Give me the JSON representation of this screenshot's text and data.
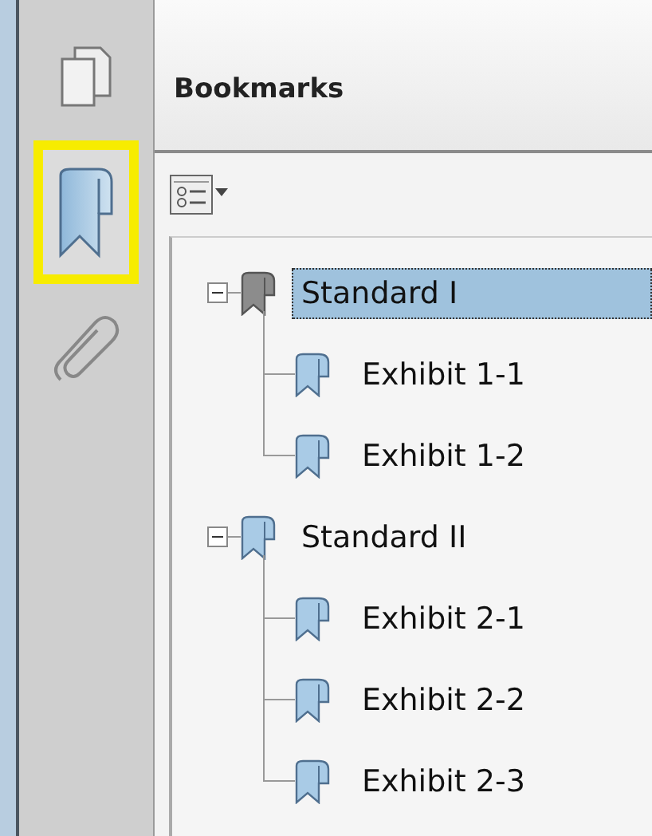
{
  "sidebar": {
    "tabs": [
      {
        "kind": "pages",
        "selected": false
      },
      {
        "kind": "bookmarks",
        "selected": true
      },
      {
        "kind": "attachments",
        "selected": false
      }
    ]
  },
  "panel": {
    "title": "Bookmarks"
  },
  "tree": [
    {
      "label": "Standard I",
      "expanded": true,
      "selected": true,
      "children": [
        {
          "label": "Exhibit 1-1",
          "selected": false
        },
        {
          "label": "Exhibit 1-2",
          "selected": false
        }
      ]
    },
    {
      "label": "Standard II",
      "expanded": true,
      "selected": false,
      "children": [
        {
          "label": "Exhibit 2-1",
          "selected": false
        },
        {
          "label": "Exhibit 2-2",
          "selected": false
        },
        {
          "label": "Exhibit 2-3",
          "selected": false
        }
      ]
    }
  ]
}
